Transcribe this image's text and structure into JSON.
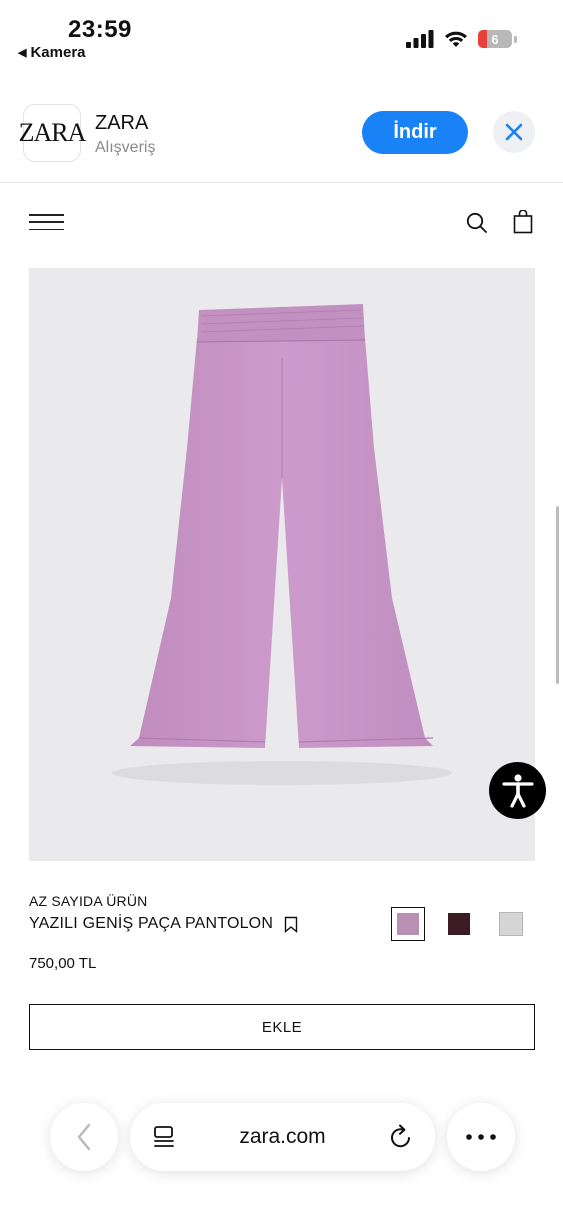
{
  "status_bar": {
    "time": "23:59",
    "back_label": "Kamera",
    "battery": "6"
  },
  "app_banner": {
    "icon_text": "ZARA",
    "name": "ZARA",
    "category": "Alışveriş",
    "get_label": "İndir"
  },
  "product": {
    "availability": "AZ SAYIDA ÜRÜN",
    "name": "YAZILI GENİŞ PAÇA PANTOLON",
    "price": "750,00 TL",
    "add_label": "EKLE",
    "image_color": "#c896c6",
    "colors": [
      {
        "hex": "#b990b4",
        "selected": true
      },
      {
        "hex": "#3b1c24",
        "selected": false
      },
      {
        "hex": "#d5d5d5",
        "selected": false
      }
    ]
  },
  "browser": {
    "url": "zara.com"
  }
}
